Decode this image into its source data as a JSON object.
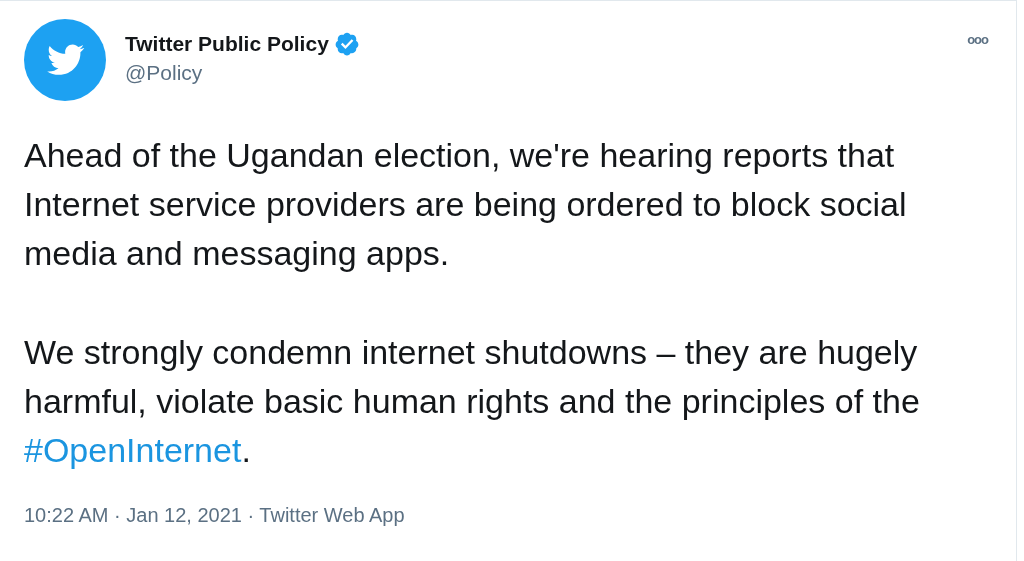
{
  "author": {
    "name": "Twitter Public Policy",
    "verified": true,
    "handle": "@Policy"
  },
  "more_button": {
    "label": "ooo"
  },
  "paragraphs": [
    [
      {
        "kind": "text",
        "text": "Ahead of the Ugandan election, we're hearing reports that Internet service providers are being ordered to block social media and messaging apps."
      }
    ],
    [
      {
        "kind": "text",
        "text": "We strongly condemn internet shutdowns – they are hugely harmful, violate basic human rights and the principles of the "
      },
      {
        "kind": "hashtag",
        "text": "#OpenInternet"
      },
      {
        "kind": "text",
        "text": "."
      }
    ]
  ],
  "meta": "10:22 AM · Jan 12, 2021 · Twitter Web App"
}
